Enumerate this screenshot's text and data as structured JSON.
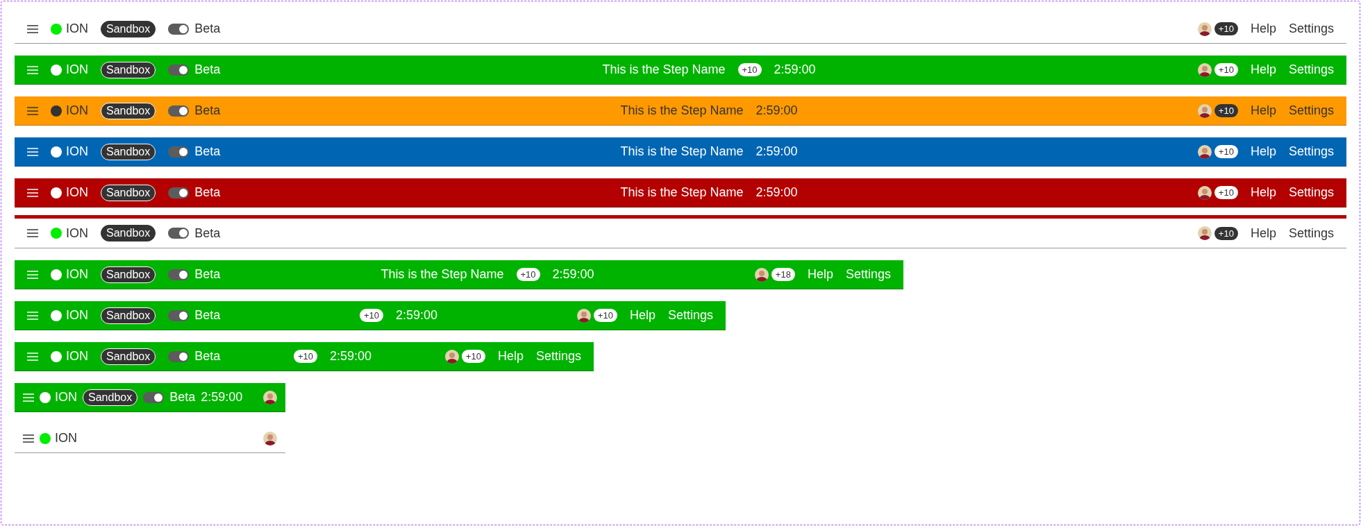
{
  "bars": [
    {
      "kind": "full",
      "filled": false,
      "color": "#ffffff",
      "dark_text": true,
      "stripe": false,
      "status": {
        "label": "ION",
        "color": "#00ee00"
      },
      "sandbox": "Sandbox",
      "beta": {
        "label": "Beta",
        "on": true
      },
      "avatar_count": "+10",
      "help": "Help",
      "settings": "Settings"
    },
    {
      "kind": "full",
      "filled": true,
      "color": "#00b300",
      "dark_text": false,
      "stripe": false,
      "status": {
        "label": "ION",
        "color": "#ffffff"
      },
      "sandbox": "Sandbox",
      "beta": {
        "label": "Beta",
        "on": true
      },
      "step_name": "This is the Step Name",
      "step_count": "+10",
      "time": "2:59:00",
      "avatar_count": "+10",
      "help": "Help",
      "settings": "Settings"
    },
    {
      "kind": "full",
      "filled": true,
      "color": "#ff9900",
      "dark_text": true,
      "stripe": false,
      "status": {
        "label": "ION",
        "color": "#333333"
      },
      "sandbox": "Sandbox",
      "beta": {
        "label": "Beta",
        "on": true
      },
      "step_name": "This is the Step Name",
      "time": "2:59:00",
      "avatar_count": "+10",
      "help": "Help",
      "settings": "Settings"
    },
    {
      "kind": "full",
      "filled": true,
      "color": "#0066b3",
      "dark_text": false,
      "stripe": false,
      "status": {
        "label": "ION",
        "color": "#ffffff"
      },
      "sandbox": "Sandbox",
      "beta": {
        "label": "Beta",
        "on": true
      },
      "step_name": "This is the Step Name",
      "time": "2:59:00",
      "avatar_count": "+10",
      "help": "Help",
      "settings": "Settings"
    },
    {
      "kind": "full",
      "filled": true,
      "color": "#b30000",
      "dark_text": false,
      "stripe": false,
      "status": {
        "label": "ION",
        "color": "#ffffff"
      },
      "sandbox": "Sandbox",
      "beta": {
        "label": "Beta",
        "on": true
      },
      "step_name": "This is the Step Name",
      "time": "2:59:00",
      "avatar_count": "+10",
      "help": "Help",
      "settings": "Settings"
    },
    {
      "kind": "full",
      "filled": false,
      "color": "#ffffff",
      "dark_text": true,
      "stripe": true,
      "status": {
        "label": "ION",
        "color": "#00ee00"
      },
      "sandbox": "Sandbox",
      "beta": {
        "label": "Beta",
        "on": true
      },
      "avatar_count": "+10",
      "help": "Help",
      "settings": "Settings"
    },
    {
      "kind": "large",
      "filled": true,
      "color": "#00b300",
      "dark_text": false,
      "stripe": false,
      "status": {
        "label": "ION",
        "color": "#ffffff"
      },
      "sandbox": "Sandbox",
      "beta": {
        "label": "Beta",
        "on": true
      },
      "step_name": "This is the Step Name",
      "step_count": "+10",
      "time": "2:59:00",
      "avatar_count": "+18",
      "help": "Help",
      "settings": "Settings"
    },
    {
      "kind": "medium",
      "filled": true,
      "color": "#00b300",
      "dark_text": false,
      "stripe": false,
      "status": {
        "label": "ION",
        "color": "#ffffff"
      },
      "sandbox": "Sandbox",
      "beta": {
        "label": "Beta",
        "on": true
      },
      "step_count": "+10",
      "time": "2:59:00",
      "avatar_count": "+10",
      "help": "Help",
      "settings": "Settings"
    },
    {
      "kind": "small",
      "filled": true,
      "color": "#00b300",
      "dark_text": false,
      "stripe": false,
      "status": {
        "label": "ION",
        "color": "#ffffff"
      },
      "sandbox": "Sandbox",
      "beta": {
        "label": "Beta",
        "on": true
      },
      "step_count": "+10",
      "time": "2:59:00",
      "avatar_count": "+10",
      "help": "Help",
      "settings": "Settings"
    },
    {
      "kind": "compact",
      "filled": true,
      "color": "#00b300",
      "dark_text": false,
      "stripe": false,
      "status": {
        "label": "ION",
        "color": "#ffffff"
      },
      "sandbox": "Sandbox",
      "beta": {
        "label": "Beta",
        "on": true
      },
      "time": "2:59:00"
    },
    {
      "kind": "compact",
      "filled": false,
      "color": "#ffffff",
      "dark_text": true,
      "stripe": false,
      "status": {
        "label": "ION",
        "color": "#00ee00"
      }
    }
  ]
}
